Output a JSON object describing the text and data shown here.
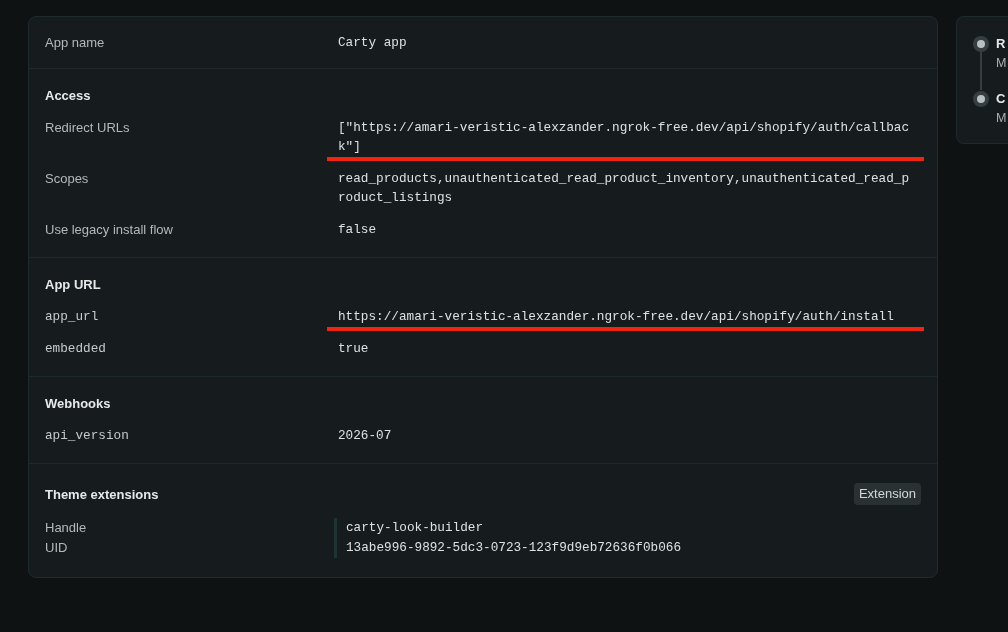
{
  "main_card": {
    "sections": [
      {
        "rows": [
          {
            "label": "App name",
            "kind": "text",
            "value": "Carty app",
            "underlined": false
          }
        ]
      },
      {
        "heading": "Access",
        "rows": [
          {
            "label": "Redirect URLs",
            "kind": "text",
            "value": "[\"https://amari-veristic-alexzander.ngrok-free.dev/api/shopify/auth/callback\"]",
            "underlined": true
          },
          {
            "label": "Scopes",
            "kind": "text",
            "value": "read_products,unauthenticated_read_product_inventory,unauthenticated_read_product_listings",
            "underlined": false
          },
          {
            "label": "Use legacy install flow",
            "kind": "text",
            "value": "false",
            "underlined": false
          }
        ]
      },
      {
        "heading": "App URL",
        "rows": [
          {
            "label": "app_url",
            "kind": "code",
            "value": "https://amari-veristic-alexzander.ngrok-free.dev/api/shopify/auth/install",
            "underlined": true
          },
          {
            "label": "embedded",
            "kind": "code",
            "value": "true",
            "underlined": false
          }
        ]
      },
      {
        "heading": "Webhooks",
        "rows": [
          {
            "label": "api_version",
            "kind": "code",
            "value": "2026-07",
            "underlined": false
          }
        ]
      }
    ],
    "theme_extensions": {
      "heading": "Theme extensions",
      "badge": "Extension",
      "items": [
        {
          "label": "Handle",
          "value": "carty-look-builder"
        },
        {
          "label": "UID",
          "value": "13abe996-9892-5dc3-0723-123f9d9eb72636f0b066"
        }
      ]
    }
  },
  "side_card": {
    "steps": [
      {
        "title": "R",
        "subtitle": "M"
      },
      {
        "title": "C",
        "subtitle": "M"
      }
    ]
  }
}
